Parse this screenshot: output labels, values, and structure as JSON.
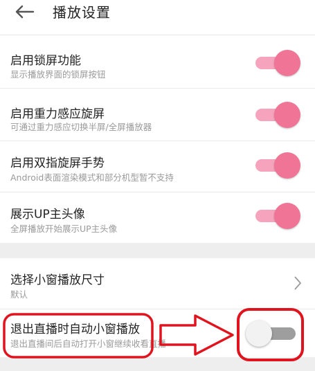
{
  "header": {
    "title": "播放设置",
    "back_icon": "arrow-left-icon"
  },
  "settings": [
    {
      "label": "启用锁屏功能",
      "desc": "显示播放界面的锁屏按钮",
      "enabled": true
    },
    {
      "label": "启用重力感应旋屏",
      "desc": "可通过重力感应切换半屏/全屏播放器",
      "enabled": true
    },
    {
      "label": "启用双指旋屏手势",
      "desc": "Android表面渲染模式和部分机型暂不支持",
      "enabled": true
    },
    {
      "label": "展示UP主头像",
      "desc": "全屏播放开始展示UP主头像",
      "enabled": true
    }
  ],
  "window_size": {
    "label": "选择小窗播放尺寸",
    "value": "默认"
  },
  "live_exit": {
    "label": "退出直播时自动小窗播放",
    "desc": "退出直播间后自动打开小窗继续收看直播",
    "enabled": false
  },
  "colors": {
    "accent": "#f07496",
    "accent_track": "#f6a4bd",
    "annotation": "#e0141e"
  }
}
